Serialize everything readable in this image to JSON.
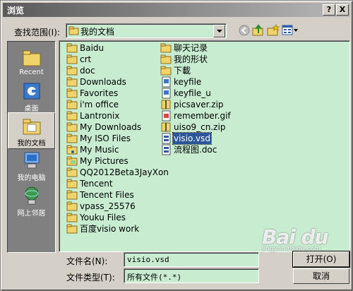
{
  "title": "浏览",
  "title_buttons": {
    "help": "?",
    "close": "X"
  },
  "look_in": {
    "label": "查找范围(I):",
    "value": "我的文档"
  },
  "toolbar_icons": [
    "back-icon",
    "up-folder-icon",
    "new-folder-icon",
    "view-menu-icon"
  ],
  "places": [
    {
      "label": "Recent",
      "icon": "recent-icon"
    },
    {
      "label": "桌面",
      "icon": "desktop-icon"
    },
    {
      "label": "我的文档",
      "icon": "my-documents-icon",
      "active": true
    },
    {
      "label": "我的电脑",
      "icon": "my-computer-icon"
    },
    {
      "label": "网上邻居",
      "icon": "network-icon"
    }
  ],
  "files_col1": [
    {
      "name": "Baidu",
      "type": "folder"
    },
    {
      "name": "crt",
      "type": "folder"
    },
    {
      "name": "doc",
      "type": "folder"
    },
    {
      "name": "Downloads",
      "type": "folder"
    },
    {
      "name": "Favorites",
      "type": "folder"
    },
    {
      "name": "i'm office",
      "type": "folder"
    },
    {
      "name": "Lantronix",
      "type": "folder"
    },
    {
      "name": "My Downloads",
      "type": "folder"
    },
    {
      "name": "My ISO Files",
      "type": "folder"
    },
    {
      "name": "My Music",
      "type": "music-folder"
    },
    {
      "name": "My Pictures",
      "type": "pictures-folder"
    },
    {
      "name": "QQ2012Beta3JayXon",
      "type": "folder"
    },
    {
      "name": "Tencent",
      "type": "folder"
    },
    {
      "name": "Tencent Files",
      "type": "folder"
    },
    {
      "name": "vpass_25576",
      "type": "folder"
    },
    {
      "name": "Youku Files",
      "type": "folder"
    },
    {
      "name": "百度visio work",
      "type": "folder"
    }
  ],
  "files_col2": [
    {
      "name": "聊天记录",
      "type": "folder"
    },
    {
      "name": "我的形状",
      "type": "folder"
    },
    {
      "name": "下載",
      "type": "folder"
    },
    {
      "name": "keyfile",
      "type": "file"
    },
    {
      "name": "keyfile_u",
      "type": "file"
    },
    {
      "name": "picsaver.zip",
      "type": "zip"
    },
    {
      "name": "remember.gif",
      "type": "gif"
    },
    {
      "name": "uiso9_cn.zip",
      "type": "zip"
    },
    {
      "name": "visio.vsd",
      "type": "vsd",
      "selected": true
    },
    {
      "name": "流程图.doc",
      "type": "vsd"
    }
  ],
  "filename": {
    "label": "文件名(N):",
    "value": "visio.vsd"
  },
  "filetype": {
    "label": "文件类型(T):",
    "value": "所有文件(*.*)"
  },
  "buttons": {
    "open": "打开(O)",
    "cancel": "取消"
  },
  "watermark": {
    "brand": "Bai du",
    "sub": "jingyan.baidu.com"
  }
}
